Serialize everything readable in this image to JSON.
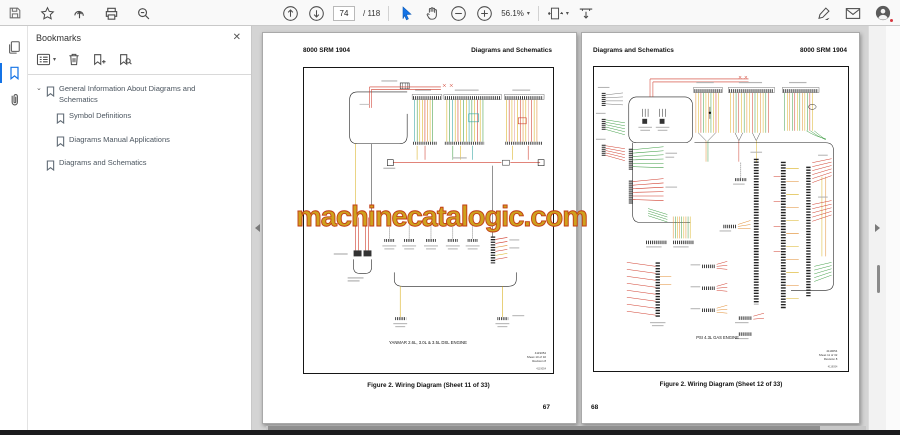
{
  "toolbar": {
    "page_current": "74",
    "page_total": "/ 118",
    "zoom_level": "56.1%"
  },
  "sidebar": {
    "rail_items": [
      "page-thumbnails",
      "bookmarks",
      "attachments"
    ],
    "panel_title": "Bookmarks",
    "bookmarks": [
      {
        "label": "General Information About Diagrams and Schematics",
        "expanded": true,
        "children": [
          {
            "label": "Symbol Definitions"
          },
          {
            "label": "Diagrams Manual Applications"
          }
        ]
      },
      {
        "label": "Diagrams and Schematics"
      }
    ]
  },
  "document": {
    "watermark": "machinecatalogic.com",
    "left_page": {
      "header_left": "8000 SRM 1904",
      "header_right": "Diagrams and Schematics",
      "diagram_caption": "YANMAR 2.6L, 3.0L & 3.5L DSL ENGINE",
      "sheet_note": [
        "4119054",
        "Sheet 10 of 32",
        "Revision 8"
      ],
      "corner_code": "4119054",
      "figure_caption": "Figure 2. Wiring Diagram (Sheet 11 of 33)",
      "page_number": "67"
    },
    "right_page": {
      "header_left": "Diagrams and Schematics",
      "header_right": "8000 SRM 1904",
      "diagram_caption": "PSI 4.3L GAS ENGINE",
      "sheet_note": [
        "4119054",
        "Sheet 11 of 32",
        "Revision 8"
      ],
      "corner_code": "4119054",
      "figure_caption": "Figure 2. Wiring Diagram (Sheet 12 of 33)",
      "page_number": "68"
    }
  },
  "colors": {
    "accent_blue": "#1473e6",
    "badge_red": "#d7373f",
    "doc_background": "#d4d4d4",
    "watermark_fill": "#cfa11d",
    "watermark_edge": "#c23d15",
    "wire_yellow": "#d9b120",
    "wire_orange": "#e08a2d",
    "wire_red": "#cf3a2a",
    "wire_green": "#3f9d44",
    "wire_teal": "#2fa3a0",
    "wire_pink": "#e49a9a"
  }
}
